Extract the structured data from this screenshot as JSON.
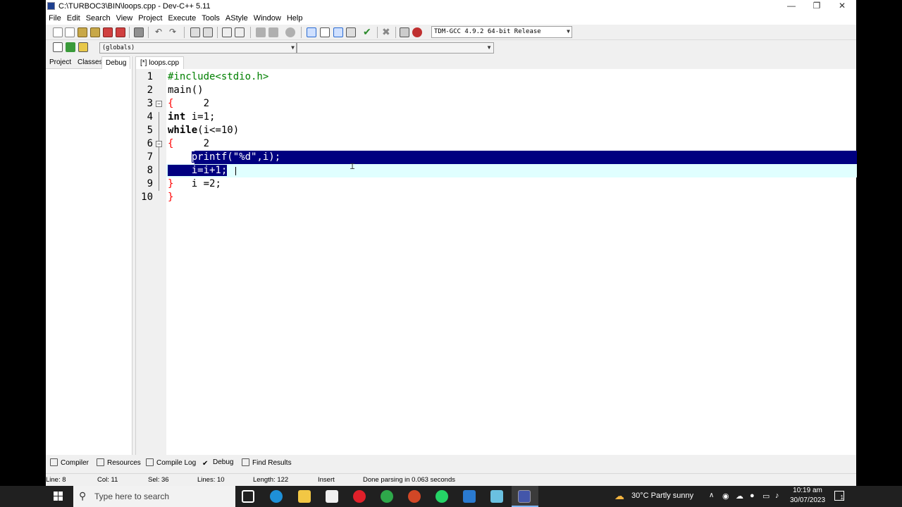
{
  "window": {
    "title": "C:\\TURBOC3\\BIN\\loops.cpp - Dev-C++ 5.11",
    "minimize": "—",
    "maximize": "❐",
    "close": "✕"
  },
  "menu": [
    "File",
    "Edit",
    "Search",
    "View",
    "Project",
    "Execute",
    "Tools",
    "AStyle",
    "Window",
    "Help"
  ],
  "toolbar": {
    "compiler": "TDM-GCC 4.9.2 64-bit Release",
    "scope": "(globals)"
  },
  "left_tabs": [
    "Project",
    "Classes",
    "Debug"
  ],
  "editor_tab": "[*] loops.cpp",
  "code": {
    "line_numbers": [
      "1",
      "2",
      "3",
      "4",
      "5",
      "6",
      "7",
      "8",
      "9",
      "10"
    ],
    "l1": "#include<stdio.h>",
    "l2": "main()",
    "l3_brace": "{",
    "l3_rest": "     2",
    "l4_kw": "int",
    "l4_rest": " i=1;",
    "l5_kw": "while",
    "l5_rest": "(i<=10)",
    "l6_brace": "{",
    "l6_rest": "     2",
    "l7_indent": "    ",
    "l7_sel": "printf(\"%d\",i);",
    "l8_sel": "    i=i+1;",
    "l9_brace": "}",
    "l9_rest": "   i =2;",
    "l10_brace": "}"
  },
  "bottom_tabs": [
    "Compiler",
    "Resources",
    "Compile Log",
    "Debug",
    "Find Results"
  ],
  "status": {
    "line": "Line:   8",
    "col": "Col:   11",
    "sel": "Sel:   36",
    "lines": "Lines:   10",
    "length": "Length:   122",
    "mode": "Insert",
    "message": "Done parsing in 0.063 seconds"
  },
  "taskbar": {
    "search_placeholder": "Type here to search",
    "weather": "30°C  Partly sunny",
    "time": "10:19 am",
    "date": "30/07/2023",
    "notifications": "1"
  },
  "colors": {
    "selection": "#000080",
    "current_line": "#e0ffff",
    "brace": "#ff0000",
    "preprocessor": "#008000"
  }
}
